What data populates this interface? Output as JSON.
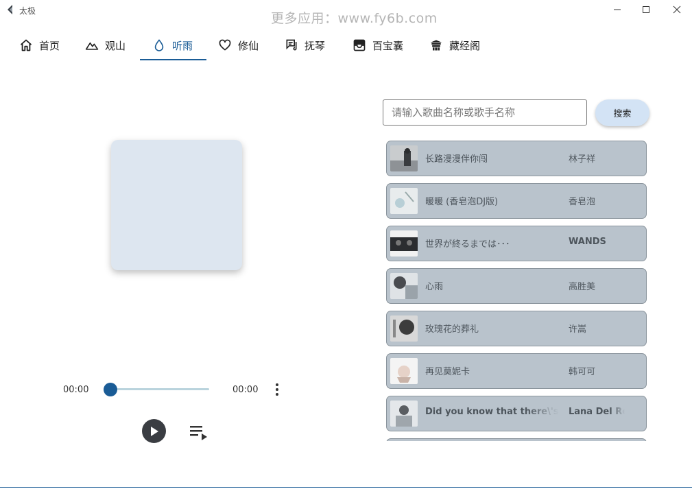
{
  "window": {
    "title": "太极",
    "watermark": "更多应用：www.fy6b.com"
  },
  "nav": {
    "tabs": [
      {
        "label": "首页",
        "icon": "home-icon"
      },
      {
        "label": "观山",
        "icon": "mountain-icon"
      },
      {
        "label": "听雨",
        "icon": "water-drop-icon"
      },
      {
        "label": "修仙",
        "icon": "heart-icon"
      },
      {
        "label": "抚琴",
        "icon": "lyrics-icon"
      },
      {
        "label": "百宝囊",
        "icon": "inbox-icon"
      },
      {
        "label": "藏经阁",
        "icon": "temple-icon"
      }
    ],
    "active_tab": "听雨"
  },
  "search": {
    "placeholder": "请输入歌曲名称或歌手名称",
    "button_label": "搜索"
  },
  "player": {
    "current_time": "00:00",
    "total_time": "00:00",
    "progress": 0
  },
  "songs": [
    {
      "title": "长路漫漫伴你闯",
      "artist": "林子祥"
    },
    {
      "title": "暖暖 (香皂泡DJ版)",
      "artist": "香皂泡"
    },
    {
      "title": "世界が終るまでは･･･",
      "artist": "WANDS"
    },
    {
      "title": "心雨",
      "artist": "高胜美"
    },
    {
      "title": "玫瑰花的葬礼",
      "artist": "许嵩"
    },
    {
      "title": "再见莫妮卡",
      "artist": "韩可可"
    },
    {
      "title": "Did you know that there\\'s a",
      "artist": "Lana Del Re"
    }
  ],
  "colors": {
    "accent": "#1a5c96",
    "song_item_bg": "#b9c3cc",
    "cover_bg": "#dde6f0",
    "search_button_bg": "#d3e3f5"
  }
}
